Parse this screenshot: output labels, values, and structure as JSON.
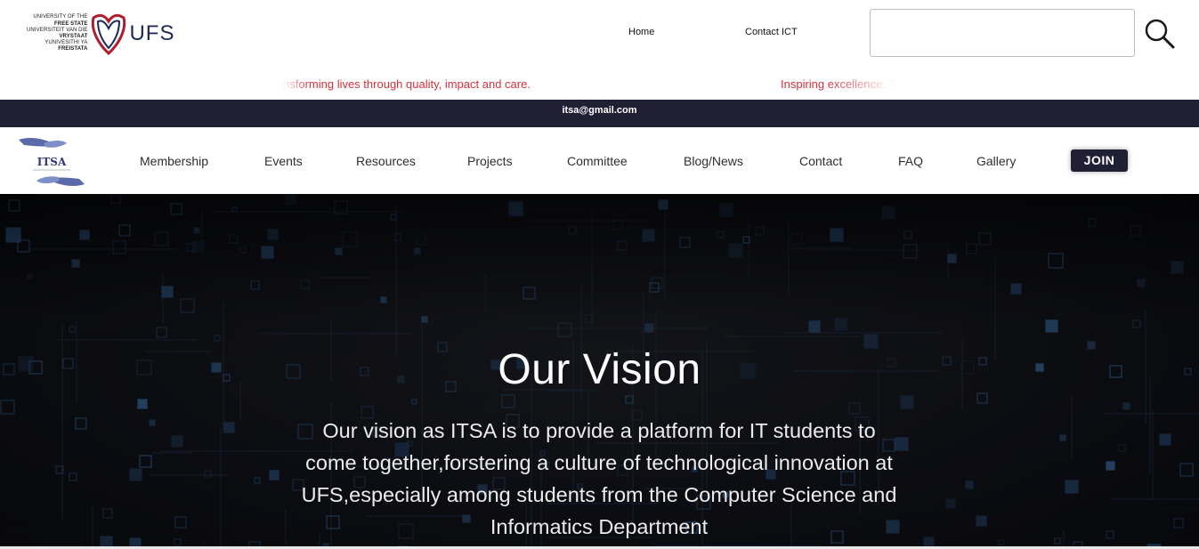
{
  "ufs_logo": {
    "lines": [
      "UNIVERSITY OF THE",
      "FREE STATE",
      "UNIVERSITEIT VAN DIE",
      "VRYSTAAT",
      "YUNIVESITHI YA",
      "FREISTATA"
    ],
    "wordmark": "UFS"
  },
  "top_nav": {
    "home": "Home",
    "contact_ict": "Contact ICT"
  },
  "search": {
    "placeholder": "",
    "value": ""
  },
  "ticker": {
    "item1": "nsforming lives through quality, impact and care.",
    "item2": "Inspiring excellence. T"
  },
  "email_bar": {
    "email": "itsa@gmail.com"
  },
  "main_nav": {
    "items": [
      "Membership",
      "Events",
      "Resources",
      "Projects",
      "Committee",
      "Blog/News",
      "Contact",
      "FAQ",
      "Gallery"
    ],
    "join": "JOIN"
  },
  "hero": {
    "title": "Our Vision",
    "lines": [
      "Our vision as ITSA is to provide a platform for IT students to",
      "come together,forstering a culture of technological innovation at",
      "UFS,especially among students from the Computer Science and",
      "Informatics Department"
    ]
  },
  "colors": {
    "dark_navy": "#211f33",
    "ticker_red": "#d8303c",
    "ufs_red": "#b01e2e",
    "ufs_navy": "#1c2a58"
  },
  "icons": [
    "search-icon",
    "itsa-logo",
    "ufs-shield-logo"
  ]
}
